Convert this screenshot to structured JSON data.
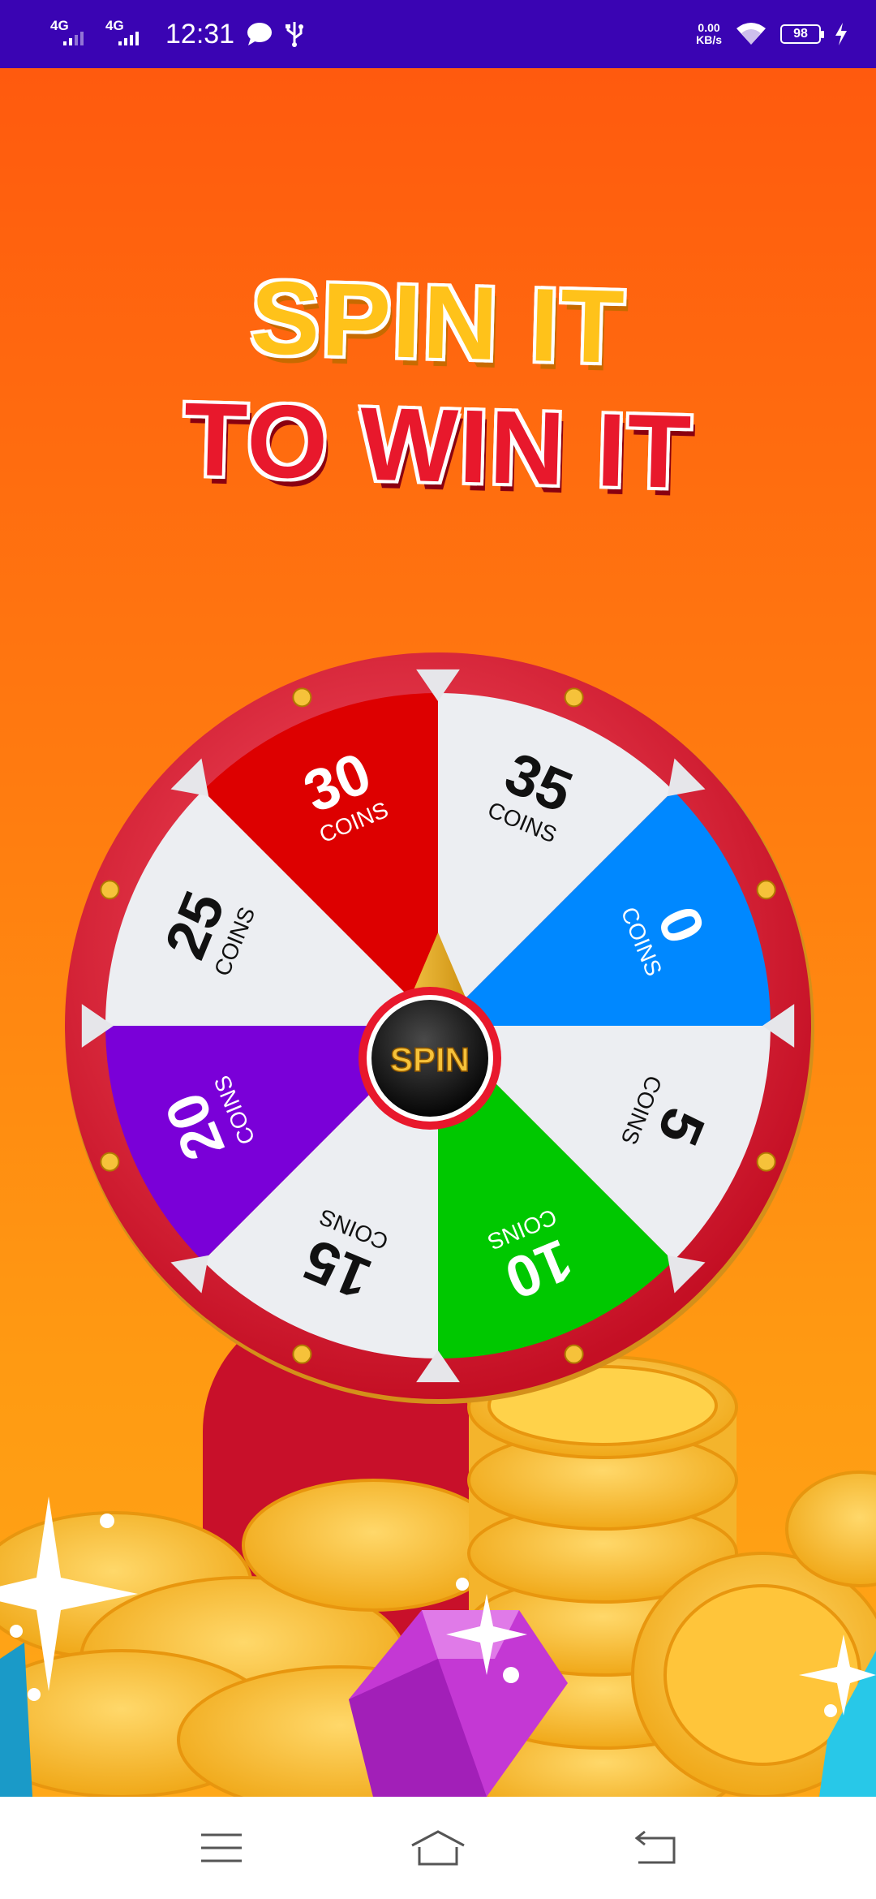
{
  "status_bar": {
    "network_1": "4G",
    "network_2": "4G",
    "time": "12:31",
    "net_speed_value": "0.00",
    "net_speed_unit": "KB/s",
    "battery_level": "98",
    "icons": [
      "chat-bubble-icon",
      "usb-icon",
      "wifi-icon",
      "battery-icon",
      "charging-bolt-icon"
    ]
  },
  "headline": {
    "line1": "SPIN IT",
    "line2": "TO WIN IT"
  },
  "wheel": {
    "center_button_label": "SPIN",
    "unit_label": "COINS",
    "segments": [
      {
        "value": "35",
        "color": "#eceef2",
        "text_color": "#111111"
      },
      {
        "value": "0",
        "color": "#0088ff",
        "text_color": "#ffffff"
      },
      {
        "value": "5",
        "color": "#eceef2",
        "text_color": "#111111"
      },
      {
        "value": "10",
        "color": "#00c800",
        "text_color": "#ffffff"
      },
      {
        "value": "15",
        "color": "#eceef2",
        "text_color": "#111111"
      },
      {
        "value": "20",
        "color": "#7a00d8",
        "text_color": "#ffffff"
      },
      {
        "value": "25",
        "color": "#eceef2",
        "text_color": "#111111"
      },
      {
        "value": "30",
        "color": "#dd0000",
        "text_color": "#ffffff"
      }
    ],
    "rim_color": "#e8182c",
    "pointer_color": "#f2b21b"
  },
  "colors": {
    "status_bar_bg": "#3a04b3",
    "game_bg_top": "#ff5a0e",
    "game_bg_bottom": "#ffa818",
    "coin": "#f7c23a"
  },
  "nav_bar": {
    "icons": [
      "menu-icon",
      "home-icon",
      "back-icon"
    ]
  }
}
